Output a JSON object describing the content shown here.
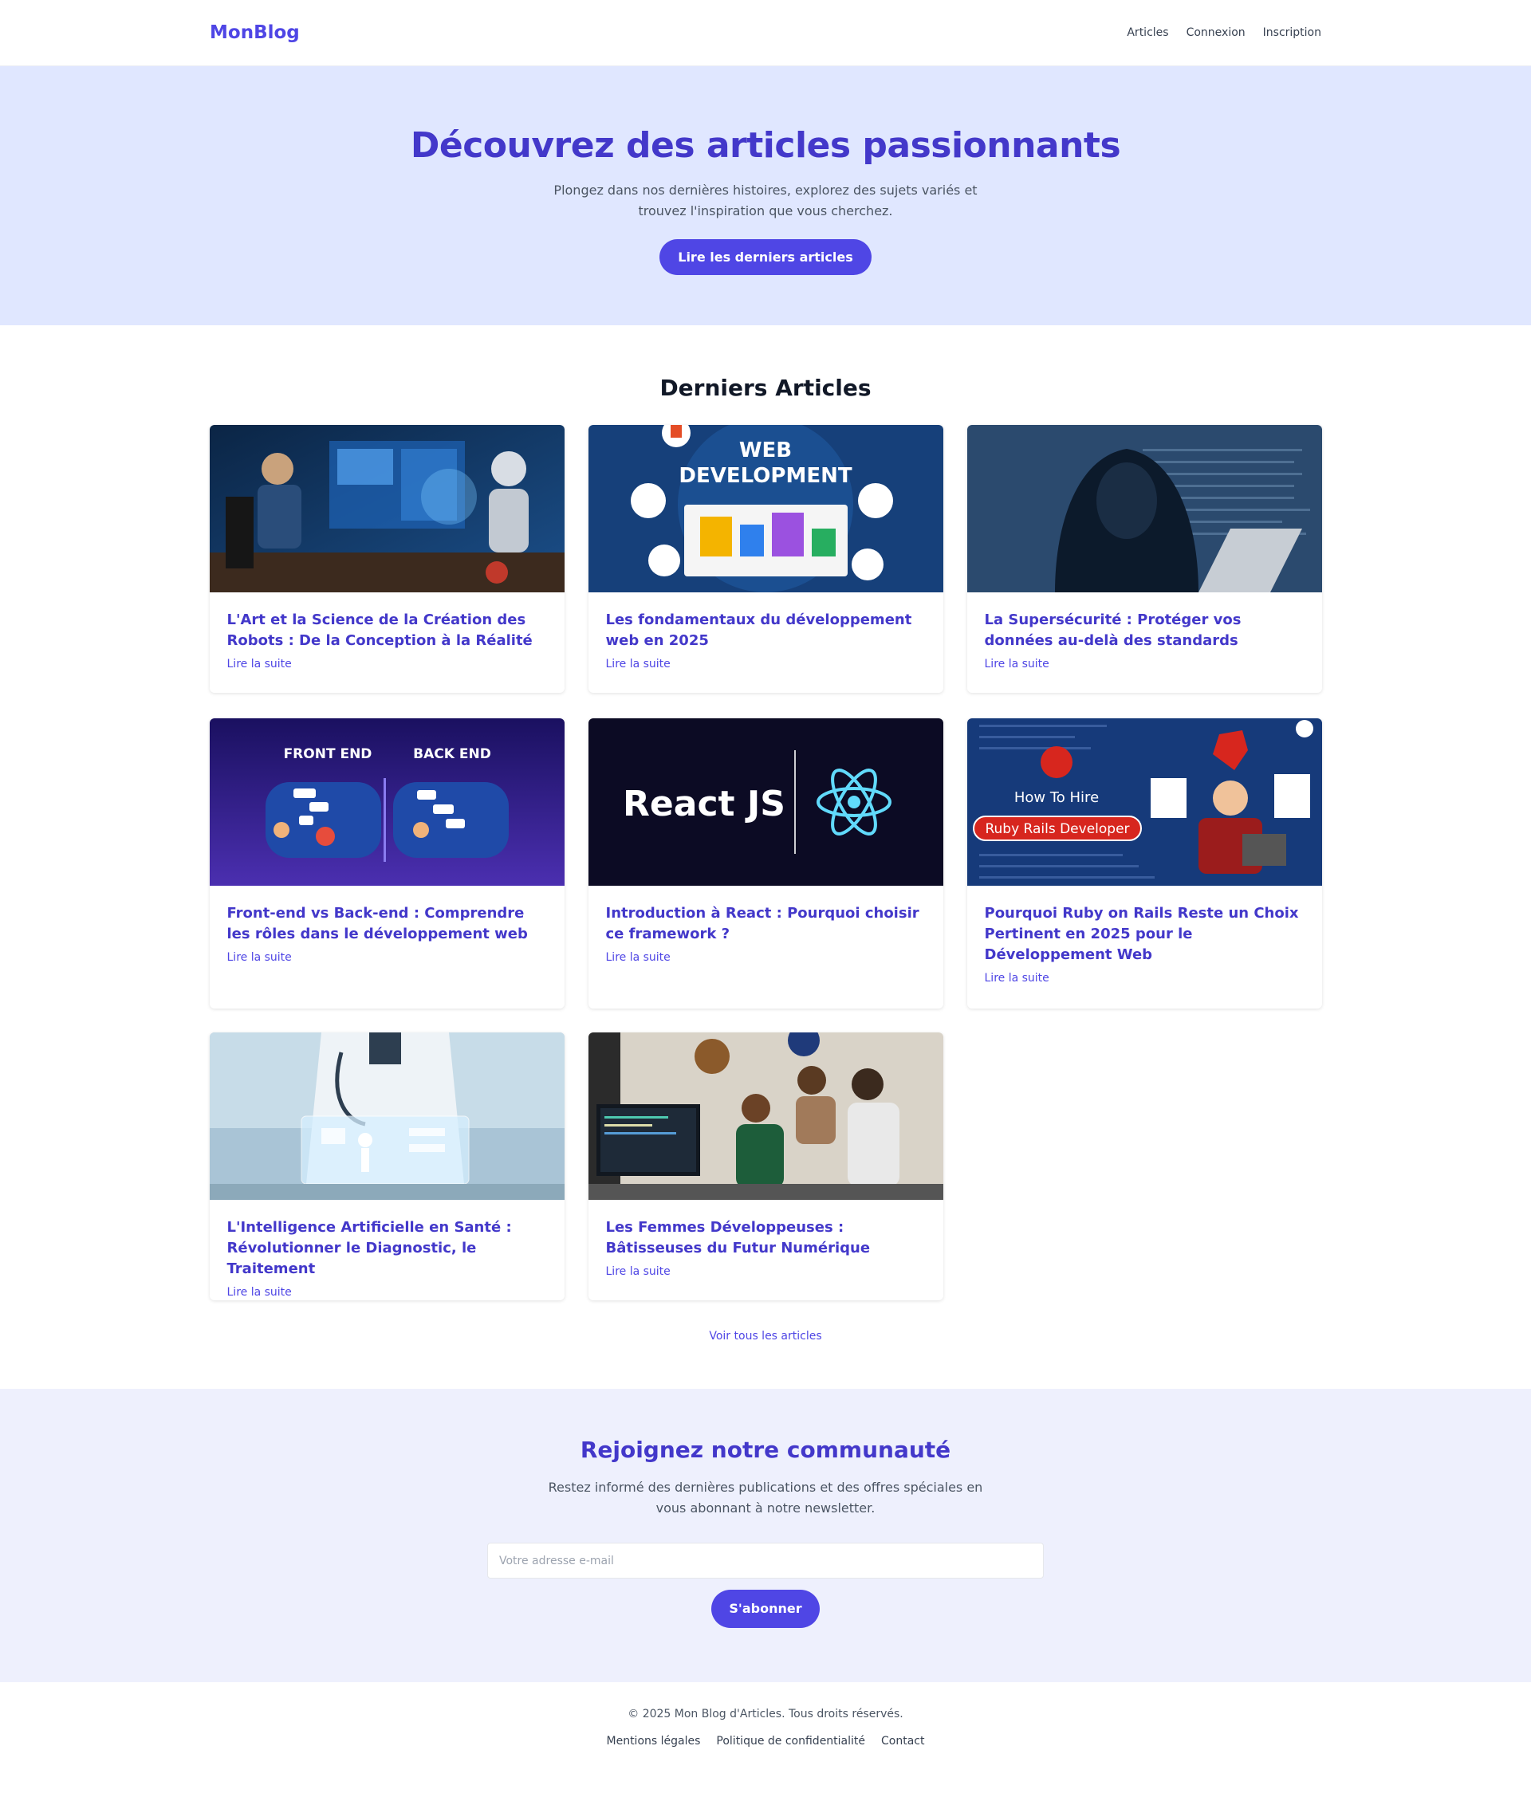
{
  "nav": {
    "logo": "MonBlog",
    "links": [
      "Articles",
      "Connexion",
      "Inscription"
    ]
  },
  "hero": {
    "title": "Découvrez des articles passionnants",
    "subtitle": "Plongez dans nos dernières histoires, explorez des sujets variés et trouvez l'inspiration que vous cherchez.",
    "cta": "Lire les derniers articles"
  },
  "articles": {
    "heading": "Derniers Articles",
    "read_more": "Lire la suite",
    "see_all": "Voir tous les articles",
    "items": [
      {
        "title": "L'Art et la Science de la Création des Robots : De la Conception à la Réalité",
        "image": "robot-workspace-image"
      },
      {
        "title": "Les fondamentaux du développement web en 2025",
        "image": "web-development-image",
        "image_text": [
          "WEB",
          "DEVELOPMENT"
        ]
      },
      {
        "title": "La Supersécurité : Protéger vos données au-delà des standards",
        "image": "hooded-hacker-image"
      },
      {
        "title": "Front-end vs Back-end : Comprendre les rôles dans le développement web",
        "image": "frontend-backend-image",
        "image_text": [
          "FRONT END",
          "BACK END"
        ]
      },
      {
        "title": "Introduction à React : Pourquoi choisir ce framework ?",
        "image": "react-logo-image",
        "image_text": [
          "React JS"
        ]
      },
      {
        "title": "Pourquoi Ruby on Rails Reste un Choix Pertinent en 2025 pour le Développement Web",
        "image": "ruby-rails-image",
        "image_text": [
          "How To Hire",
          "Ruby Rails Developer"
        ]
      },
      {
        "title": "L'Intelligence Artificielle en Santé : Révolutionner le Diagnostic, le Traitement",
        "image": "ai-health-image"
      },
      {
        "title": "Les Femmes Développeuses : Bâtisseuses du Futur Numérique",
        "image": "women-developers-image"
      }
    ]
  },
  "newsletter": {
    "title": "Rejoignez notre communauté",
    "text": "Restez informé des dernières publications et des offres spéciales en vous abonnant à notre newsletter.",
    "placeholder": "Votre adresse e-mail",
    "button": "S'abonner"
  },
  "footer": {
    "copyright": "© 2025 Mon Blog d'Articles. Tous droits réservés.",
    "links": [
      "Mentions légales",
      "Politique de confidentialité",
      "Contact"
    ]
  }
}
